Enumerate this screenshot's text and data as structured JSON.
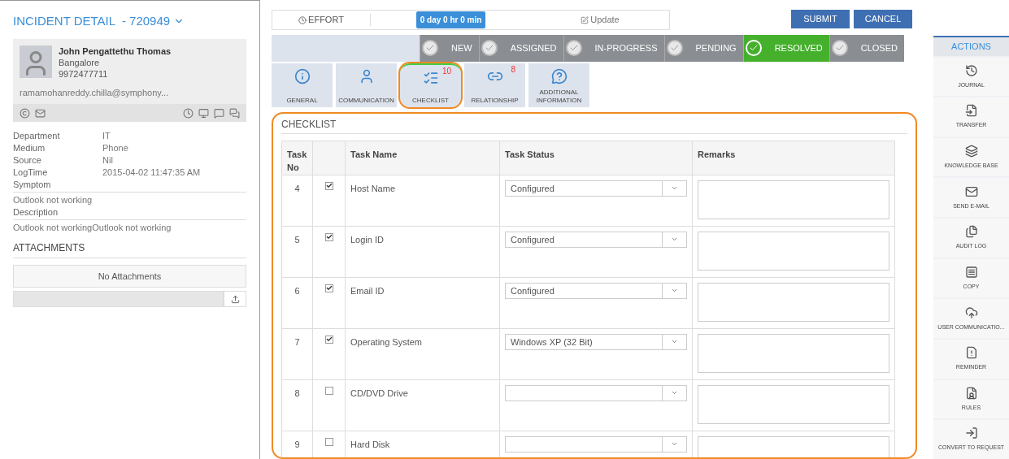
{
  "title": "INCIDENT DETAIL  - 720949",
  "contact": {
    "name": "John Pengattethu Thomas",
    "city": "Bangalore",
    "phone": "9972477711",
    "email": "ramamohanreddy.chilla@symphony..."
  },
  "details": [
    {
      "label": "Department",
      "value": "IT"
    },
    {
      "label": "Medium",
      "value": "Phone"
    },
    {
      "label": "Source",
      "value": "Nil"
    },
    {
      "label": "LogTime",
      "value": "2015-04-02 11:47:35 AM"
    }
  ],
  "blocks": [
    {
      "label": "Symptom",
      "value": "Outlook not working"
    },
    {
      "label": "Description",
      "value": "Outlook not workingOutlook not working"
    }
  ],
  "attachments": {
    "heading": "ATTACHMENTS",
    "empty": "No Attachments"
  },
  "effort": {
    "label": "EFFORT",
    "time": "0 day 0 hr 0 min",
    "update": "Update"
  },
  "buttons": [
    "SUBMIT",
    "CANCEL"
  ],
  "steps": [
    {
      "label": "NEW",
      "selected": false
    },
    {
      "label": "ASSIGNED",
      "selected": false
    },
    {
      "label": "IN-PROGRESS",
      "selected": false
    },
    {
      "label": "PENDING",
      "selected": false
    },
    {
      "label": "RESOLVED",
      "selected": true
    },
    {
      "label": "CLOSED",
      "selected": false
    }
  ],
  "tabs": [
    {
      "kind": "info",
      "label": "GENERAL",
      "selected": false
    },
    {
      "kind": "person",
      "label": "COMMUNICATION",
      "selected": false
    },
    {
      "kind": "checklist",
      "label": "CHECKLIST",
      "count": "10",
      "selected": true
    },
    {
      "kind": "link",
      "label": "RELATIONSHIP",
      "count": "8",
      "selected": false
    },
    {
      "kind": "help",
      "label": "ADDITIONAL INFORMATION",
      "selected": false
    }
  ],
  "checklist": {
    "title": "CHECKLIST",
    "columns": [
      "Task No",
      "Task Name",
      "Task Status",
      "Remarks"
    ],
    "rows": [
      {
        "no": "4",
        "checked": true,
        "name": "Host Name",
        "status": "Configured"
      },
      {
        "no": "5",
        "checked": true,
        "name": "Login ID",
        "status": "Configured"
      },
      {
        "no": "6",
        "checked": true,
        "name": "Email ID",
        "status": "Configured"
      },
      {
        "no": "7",
        "checked": true,
        "name": "Operating System",
        "status": "Windows XP (32 Bit)"
      },
      {
        "no": "8",
        "checked": false,
        "name": "CD/DVD Drive",
        "status": ""
      },
      {
        "no": "9",
        "checked": false,
        "name": "Hard Disk",
        "status": ""
      }
    ]
  },
  "actions": {
    "title": "ACTIONS",
    "items": [
      {
        "kind": "journal",
        "label": "JOURNAL"
      },
      {
        "kind": "transfer",
        "label": "TRANSFER"
      },
      {
        "kind": "kb",
        "label": "KNOWLEDGE BASE"
      },
      {
        "kind": "mail",
        "label": "SEND E-MAIL"
      },
      {
        "kind": "audit",
        "label": "AUDIT LOG"
      },
      {
        "kind": "copy",
        "label": "COPY"
      },
      {
        "kind": "usercomm",
        "label": "USER COMMUNICATIO..."
      },
      {
        "kind": "reminder",
        "label": "REMINDER"
      },
      {
        "kind": "rules",
        "label": "RULES"
      },
      {
        "kind": "convert",
        "label": "CONVERT TO REQUEST"
      }
    ]
  }
}
